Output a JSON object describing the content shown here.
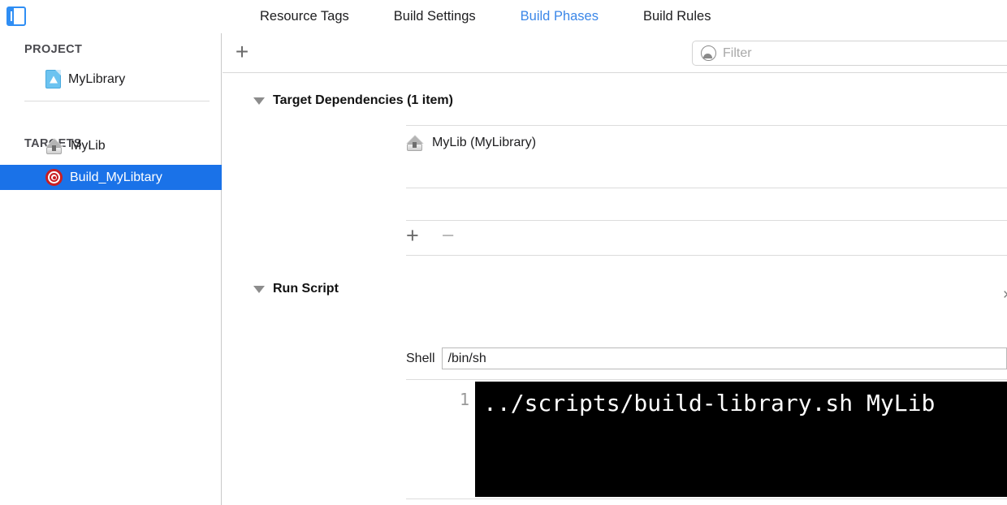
{
  "toolbar": {
    "nav_toggle_icon": "navigator-panel-toggle-icon",
    "tabs": [
      {
        "label": "Resource Tags",
        "active": false
      },
      {
        "label": "Build Settings",
        "active": false
      },
      {
        "label": "Build Phases",
        "active": true
      },
      {
        "label": "Build Rules",
        "active": false
      }
    ],
    "active_tab_color": "#3b87e8"
  },
  "sidebar": {
    "project_header": "PROJECT",
    "targets_header": "TARGETS",
    "project_items": [
      {
        "label": "MyLibrary",
        "icon": "xcode-project-document-icon",
        "selected": false
      }
    ],
    "target_items": [
      {
        "label": "MyLib",
        "icon": "framework-bundle-icon",
        "selected": false
      },
      {
        "label": "Build_MyLibtary",
        "icon": "aggregate-target-icon",
        "selected": true
      }
    ],
    "selection_color": "#1a72e8"
  },
  "filter_bar": {
    "add_icon": "plus-icon",
    "filter_icon": "filter-funnel-icon",
    "filter_placeholder": "Filter",
    "filter_value": ""
  },
  "phases": {
    "target_dependencies": {
      "title": "Target Dependencies (1 item)",
      "expanded": true,
      "disclosure_icon": "disclosure-triangle-down-icon",
      "rows": [
        {
          "label": "MyLib (MyLibrary)",
          "icon": "framework-bundle-icon"
        }
      ],
      "add_button": "+",
      "remove_button": "−"
    },
    "run_script": {
      "title": "Run Script",
      "expanded": true,
      "disclosure_icon": "disclosure-triangle-down-icon",
      "close_icon": "×",
      "shell_label": "Shell",
      "shell_value": "/bin/sh",
      "editor": {
        "line_number": "1",
        "code": "../scripts/build-library.sh MyLib"
      }
    }
  }
}
